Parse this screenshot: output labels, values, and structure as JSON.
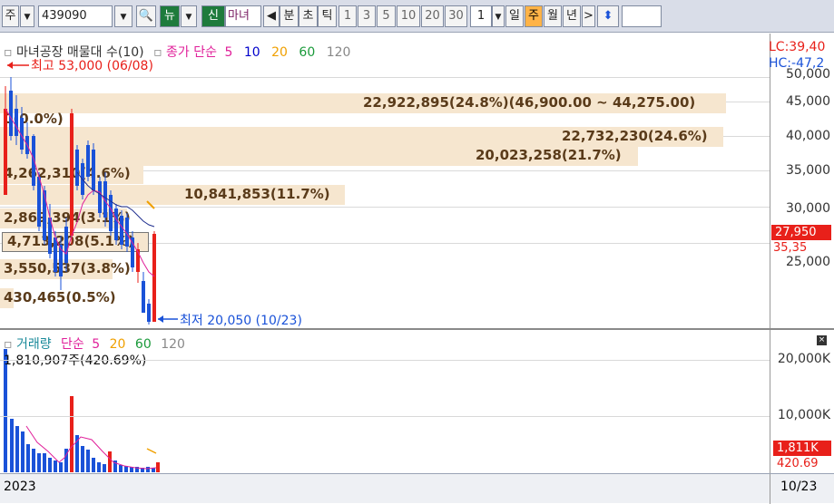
{
  "toolbar": {
    "market": "주",
    "code": "439090",
    "news_label": "뉴",
    "credit_label": "신",
    "stock_name": "마녀",
    "period_buttons": [
      "분",
      "초",
      "틱"
    ],
    "num_buttons": [
      "1",
      "3",
      "5",
      "10",
      "20",
      "30"
    ],
    "interval_value": "1",
    "timeframes": [
      "일",
      "주",
      "월",
      "년"
    ],
    "selected_timeframe": "주"
  },
  "price_panel": {
    "legend_title": "마녀공장 매물대 수(10)",
    "legend_ma": "종가 단순",
    "ma_periods": [
      "5",
      "10",
      "20",
      "60",
      "120"
    ],
    "ma_colors": [
      "#e0209a",
      "#0000cc",
      "#f0a000",
      "#1a9a3a",
      "#888888"
    ],
    "lc": "LC:39,40",
    "hc": "HC:-47,2",
    "high_marker": "최고 53,000 (06/08)",
    "low_marker": "최저 20,050 (10/23)",
    "current_price": "27,950",
    "current_pct": "35,35",
    "y_ticks": [
      "50,000",
      "45,000",
      "40,000",
      "35,000",
      "30,000",
      "25,000"
    ],
    "volume_profile": [
      {
        "label": "22,922,895(24.8%)(46,900.00 ~ 44,275.00)",
        "pct": 24.8
      },
      {
        "label": "22,732,230(24.6%)",
        "pct": 24.6
      },
      {
        "label": "20,023,258(21.7%)",
        "pct": 21.7
      },
      {
        "label": "10,841,853(11.7%)",
        "pct": 11.7
      },
      {
        "label": "4,713,208(5.1%)",
        "pct": 5.1
      },
      {
        "label": "4,262,310(4.6%)",
        "pct": 4.6
      },
      {
        "label": "3,550,537(3.8%)",
        "pct": 3.8
      },
      {
        "label": "2,869,394(3.1%)",
        "pct": 3.1
      },
      {
        "label": "430,465(0.5%)",
        "pct": 0.5
      },
      {
        "label": "0(0.0%)",
        "pct": 0.0
      }
    ],
    "candle_colors": {
      "up": "#e8201a",
      "down": "#1a52d8"
    }
  },
  "volume_panel": {
    "legend_title": "거래량",
    "legend_ma": "단순",
    "ma_periods": [
      "5",
      "20",
      "60",
      "120"
    ],
    "ma_colors": [
      "#e0209a",
      "#f0a000",
      "#1a9a3a",
      "#888888"
    ],
    "last_volume": "1,810,907주(420.69%)",
    "current_volume": "1,811K",
    "current_pct": "420.69",
    "y_ticks": [
      "20,000K",
      "10,000K"
    ]
  },
  "footer": {
    "year": "2023",
    "date": "10/23"
  }
}
